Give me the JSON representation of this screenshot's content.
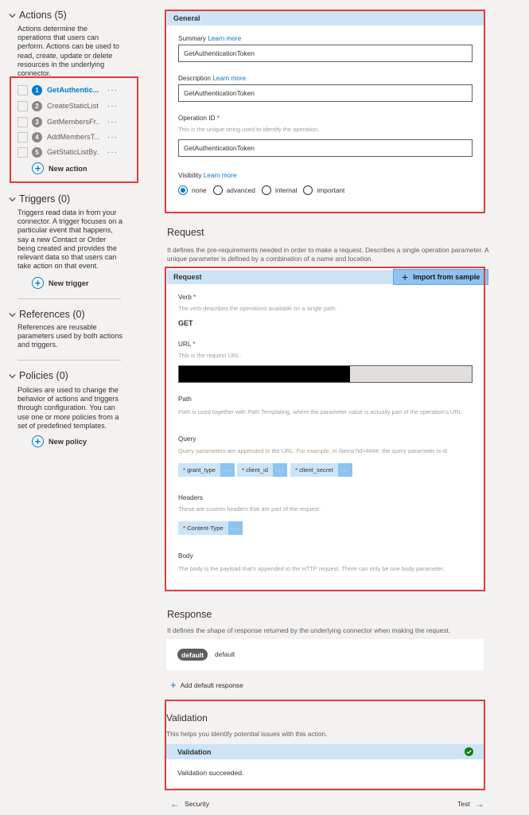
{
  "sidebar": {
    "actions": {
      "title": "Actions (5)",
      "description": "Actions determine the operations that users can perform. Actions can be used to read, create, update or delete resources in the underlying connector.",
      "items": [
        {
          "num": "1",
          "label": "GetAuthentic...",
          "active": true
        },
        {
          "num": "2",
          "label": "CreateStaticList",
          "active": false
        },
        {
          "num": "3",
          "label": "GetMembersFr...",
          "active": false
        },
        {
          "num": "4",
          "label": "AddMembersT...",
          "active": false
        },
        {
          "num": "5",
          "label": "GetStaticListBy...",
          "active": false
        }
      ],
      "more": "···",
      "new_label": "New action"
    },
    "triggers": {
      "title": "Triggers (0)",
      "description": "Triggers read data in from your connector. A trigger focuses on a particular event that happens, say a new Contact or Order being created and provides the relevant data so that users can take action on that event.",
      "new_label": "New trigger"
    },
    "references": {
      "title": "References (0)",
      "description": "References are reusable parameters used by both actions and triggers."
    },
    "policies": {
      "title": "Policies (0)",
      "description": "Policies are used to change the behavior of actions and triggers through configuration. You can use one or more policies from a set of predefined templates.",
      "new_label": "New policy"
    }
  },
  "general": {
    "header": "General",
    "summary_label": "Summary",
    "learn_more": "Learn more",
    "summary_value": "GetAuthenticationToken",
    "description_label": "Description",
    "description_value": "GetAuthenticationToken",
    "operation_id_label": "Operation ID",
    "required_mark": "*",
    "operation_id_hint": "This is the unique string used to identify the operation.",
    "operation_id_value": "GetAuthenticationToken",
    "visibility_label": "Visibility",
    "visibility_options": [
      "none",
      "advanced",
      "internal",
      "important"
    ],
    "visibility_selected": "none"
  },
  "request": {
    "title": "Request",
    "description": "It defines the pre-requirements needed in order to make a request. Describes a single operation parameter. A unique parameter is defined by a combination of a name and location.",
    "header": "Request",
    "import_label": "Import from sample",
    "verb_label": "Verb",
    "verb_hint": "The verb describes the operations available on a single path.",
    "verb_value": "GET",
    "url_label": "URL",
    "url_hint": "This is the request URL.",
    "path_label": "Path",
    "path_hint": "Path is used together with Path Templating, where the parameter value is actually part of the operation's URL.",
    "query_label": "Query",
    "query_hint": "Query parameters are appended to the URL. For example, in /items?id=####, the query parameter is id.",
    "query_params": [
      "* grant_type",
      "* client_id",
      "* client_secret"
    ],
    "headers_label": "Headers",
    "headers_hint": "These are custom headers that are part of the request.",
    "header_params": [
      "* Content-Type"
    ],
    "body_label": "Body",
    "body_hint": "The body is the payload that's appended to the HTTP request. There can only be one body parameter.",
    "chip_more": "···"
  },
  "response": {
    "title": "Response",
    "description": "It defines the shape of response returned by the underlying connector when making the request.",
    "pill": "default",
    "name": "default",
    "add_label": "Add default response"
  },
  "validation": {
    "title": "Validation",
    "description": "This helps you identify potential issues with this action.",
    "header": "Validation",
    "message": "Validation succeeded."
  },
  "footer": {
    "back_label": "Security",
    "next_label": "Test"
  },
  "colors": {
    "accent": "#0078d4",
    "highlight_border": "#e03c3c",
    "success": "#107c10"
  }
}
